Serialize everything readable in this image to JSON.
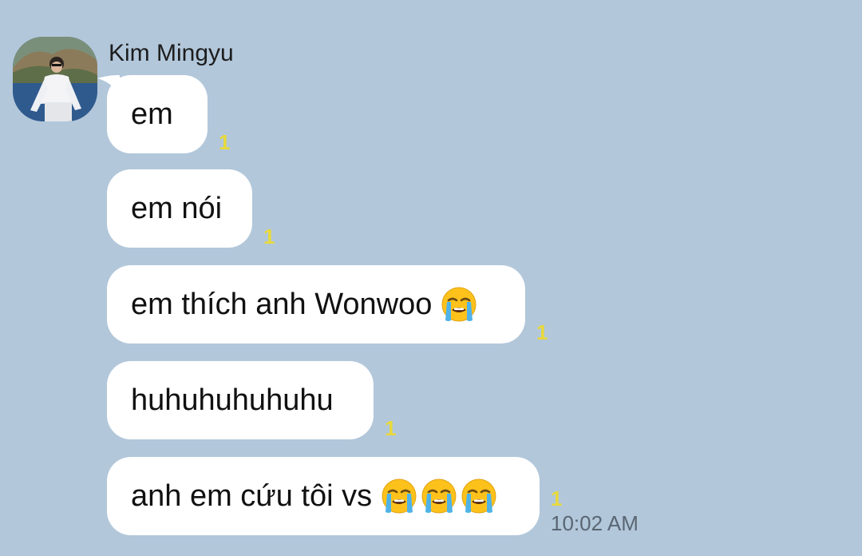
{
  "background_color": "#b2c7da",
  "sender": {
    "name": "Kim Mingyu",
    "avatar_icon": "profile-photo"
  },
  "messages": [
    {
      "text": "em",
      "emoji_count": 0,
      "unread": "1"
    },
    {
      "text": "em nói",
      "emoji_count": 0,
      "unread": "1"
    },
    {
      "text": "em thích anh Wonwoo",
      "emoji_count": 1,
      "unread": "1"
    },
    {
      "text": "huhuhuhuhuhu",
      "emoji_count": 0,
      "unread": "1"
    },
    {
      "text": "anh em cứu tôi vs",
      "emoji_count": 3,
      "unread": "1",
      "time": "10:02 AM"
    }
  ],
  "emoji_icon": "loudly-crying-face-icon",
  "colors": {
    "bubble": "#ffffff",
    "unread_badge": "#e8d93c",
    "timestamp": "#5a6673"
  }
}
